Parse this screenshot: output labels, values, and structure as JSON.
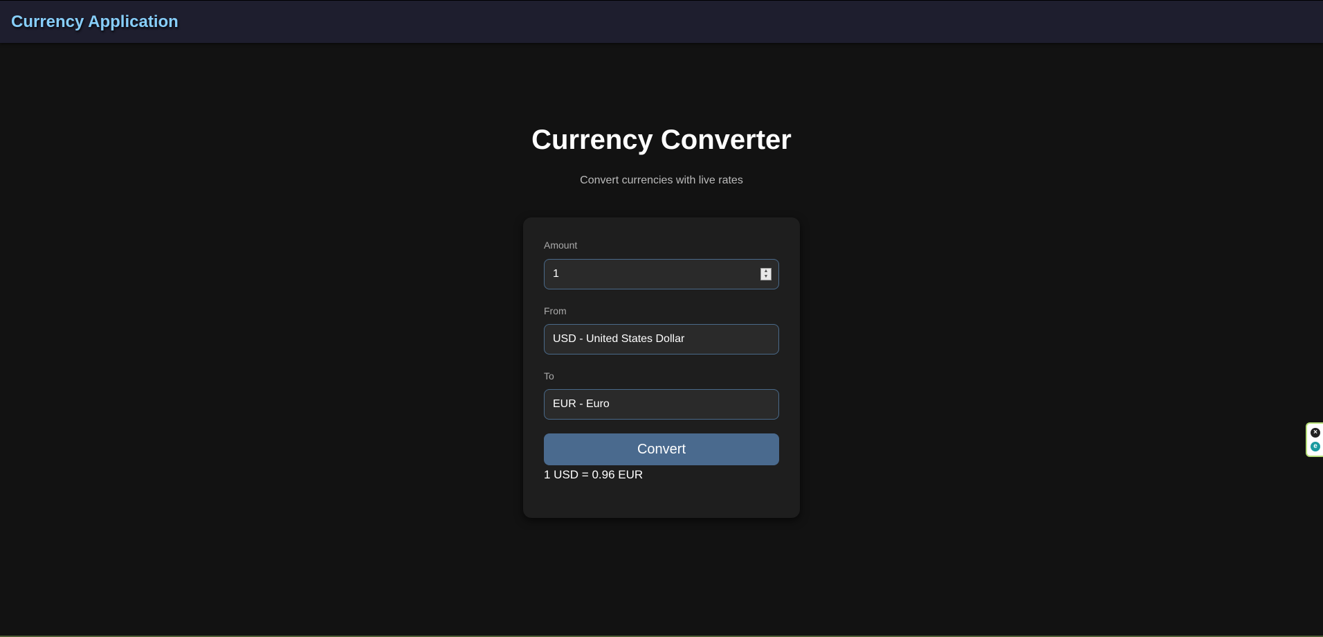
{
  "header": {
    "app_title": "Currency Application"
  },
  "hero": {
    "title": "Currency Converter",
    "subtitle": "Convert currencies with live rates"
  },
  "form": {
    "amount_label": "Amount",
    "amount_value": "1",
    "from_label": "From",
    "from_value": "USD - United States Dollar",
    "to_label": "To",
    "to_value": "EUR - Euro",
    "convert_label": "Convert",
    "result_text": "1 USD = 0.96 EUR"
  },
  "colors": {
    "accent_title": "#87cefa",
    "button": "#4a6a8e",
    "background": "#121212",
    "card": "#1e1e1e"
  },
  "icons": {
    "stepper": "stepper-arrows-icon",
    "ext_close": "close-icon",
    "ext_logo": "extension-logo-icon"
  }
}
